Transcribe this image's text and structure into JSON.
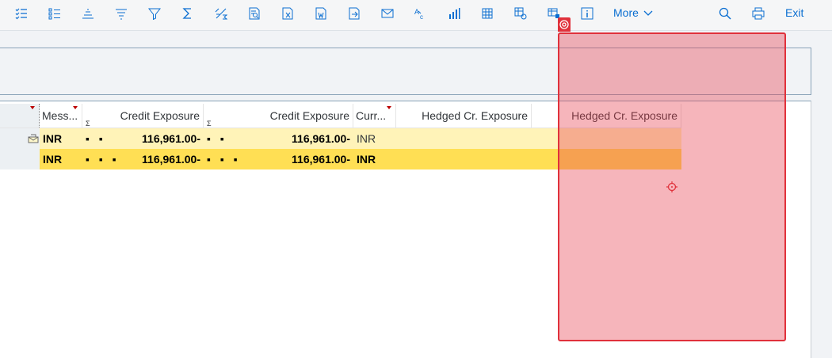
{
  "toolbar": {
    "icons": [
      "checklist-icon",
      "list-icon",
      "align-top-icon",
      "filter-lines-icon",
      "filter-icon",
      "sum-icon",
      "subtotal-icon",
      "print-preview-icon",
      "export-excel-icon",
      "export-word-icon",
      "export-local-icon",
      "mail-icon",
      "abc-icon",
      "bar-chart-icon",
      "layout-grid-icon",
      "grid-settings-icon",
      "table-view-icon",
      "info-icon"
    ],
    "more_label": "More",
    "exit_label": "Exit"
  },
  "grid": {
    "columns": [
      {
        "label": "Mess..."
      },
      {
        "label": "Credit Exposure"
      },
      {
        "label": "Credit Exposure"
      },
      {
        "label": "Curr..."
      },
      {
        "label": "Hedged Cr. Exposure"
      },
      {
        "label": "Hedged Cr. Exposure"
      }
    ],
    "rows": [
      {
        "message": "INR",
        "dots1": "▪ ▪",
        "credit1": "116,961.00-",
        "dots2": "▪ ▪",
        "credit2": "116,961.00-",
        "currency": "INR"
      },
      {
        "message": "INR",
        "dots1": "▪ ▪ ▪",
        "credit1": "116,961.00-",
        "dots2": "▪ ▪ ▪",
        "credit2": "116,961.00-",
        "currency": "INR"
      }
    ]
  },
  "colors": {
    "accent": "#0a6ed1",
    "row_highlight": "#fff3b8",
    "row_selected": "#ffdf54",
    "overlay": "#e0313b"
  }
}
